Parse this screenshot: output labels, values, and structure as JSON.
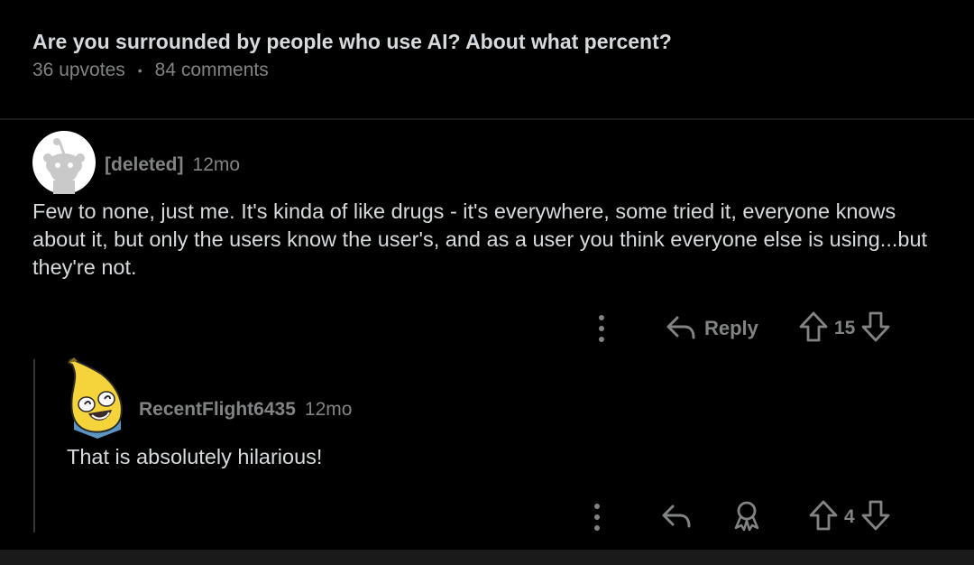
{
  "post": {
    "title": "Are you surrounded by people who use AI? About what percent?",
    "upvotes": "36 upvotes",
    "separator": "•",
    "comments": "84 comments"
  },
  "comments": [
    {
      "username": "[deleted]",
      "age": "12mo",
      "body": "Few to none, just me. It's kinda of like drugs - it's everywhere, some tried it, everyone knows about it, but only the users know the user's, and as a user you think everyone else is using...but they're not.",
      "reply_label": "Reply",
      "score": "15",
      "avatar": "snoo-avatar-icon"
    },
    {
      "username": "RecentFlight6435",
      "age": "12mo",
      "body": "That is absolutely hilarious!",
      "score": "4",
      "avatar": "banana-avatar-icon"
    }
  ],
  "colors": {
    "background": "#000000",
    "text": "#d7dadc",
    "muted": "#818384",
    "thread_line": "#343536",
    "banana": "#f5d33b"
  }
}
